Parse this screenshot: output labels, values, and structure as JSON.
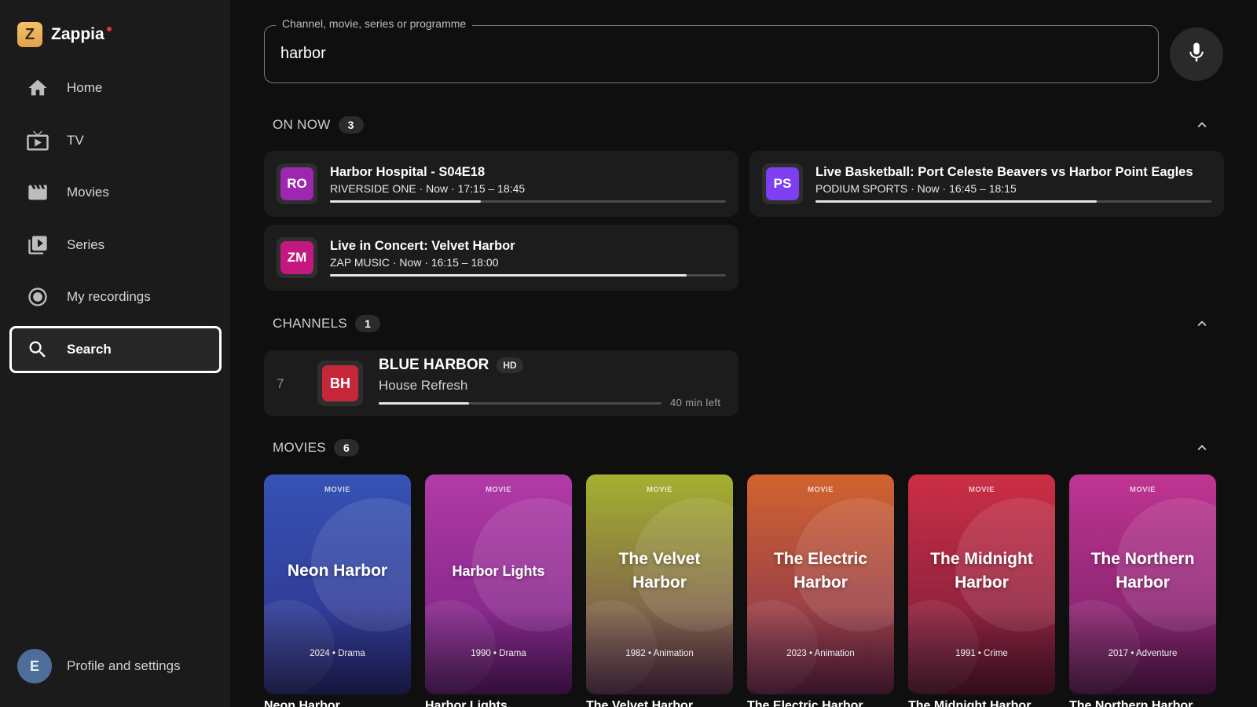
{
  "app": {
    "name": "Zappia",
    "logo_letter": "Z"
  },
  "sidebar": {
    "items": [
      {
        "label": "Home",
        "icon": "home-icon"
      },
      {
        "label": "TV",
        "icon": "tv-icon"
      },
      {
        "label": "Movies",
        "icon": "clapperboard-icon"
      },
      {
        "label": "Series",
        "icon": "series-icon"
      },
      {
        "label": "My recordings",
        "icon": "record-icon"
      },
      {
        "label": "Search",
        "icon": "search-icon",
        "active": true
      }
    ],
    "profile": {
      "initial": "E",
      "label": "Profile and settings",
      "avatar_color": "#4e6e9a"
    }
  },
  "search": {
    "label": "Channel, movie, series or programme",
    "value": "harbor"
  },
  "on_now": {
    "title": "ON NOW",
    "count": "3",
    "items": [
      {
        "logo": "RO",
        "logo_color": "#9c27b0",
        "title": "Harbor Hospital - S04E18",
        "meta": "RIVERSIDE ONE · Now · 17:15 – 18:45",
        "progress": 0.38
      },
      {
        "logo": "PS",
        "logo_color": "#7e3ff2",
        "title": "Live Basketball: Port Celeste Beavers vs Harbor Point Eagles",
        "meta": "PODIUM SPORTS · Now · 16:45 – 18:15",
        "progress": 0.71
      },
      {
        "logo": "ZM",
        "logo_color": "#c2187f",
        "title": "Live in Concert: Velvet Harbor",
        "meta": "ZAP MUSIC · Now · 16:15 – 18:00",
        "progress": 0.9
      }
    ]
  },
  "channels": {
    "title": "CHANNELS",
    "count": "1",
    "items": [
      {
        "number": "7",
        "logo": "BH",
        "logo_color": "#c62839",
        "name": "BLUE HARBOR",
        "badge": "HD",
        "program": "House Refresh",
        "time_left": "40 min left",
        "progress": 0.32
      }
    ]
  },
  "movies": {
    "title": "MOVIES",
    "count": "6",
    "items": [
      {
        "kind": "MOVIE",
        "title": "Neon Harbor",
        "sub": "2024 • Drama",
        "caption": "Neon Harbor",
        "colors": [
          "#3553b5",
          "#2f2f86"
        ]
      },
      {
        "kind": "MOVIE",
        "title": "Harbor Lights",
        "sub": "1990 • Drama",
        "caption": "Harbor Lights",
        "colors": [
          "#b23aa7",
          "#6f1f7e"
        ]
      },
      {
        "kind": "MOVIE",
        "title": "The Velvet Harbor",
        "sub": "1982 • Animation",
        "caption": "The Velvet Harbor",
        "colors": [
          "#a5b12f",
          "#6c3a5a"
        ]
      },
      {
        "kind": "MOVIE",
        "title": "The Electric Harbor",
        "sub": "2023 • Animation",
        "caption": "The Electric Harbor",
        "colors": [
          "#d2632f",
          "#7a2c55"
        ]
      },
      {
        "kind": "MOVIE",
        "title": "The Midnight Harbor",
        "sub": "1991 • Crime",
        "caption": "The Midnight Harbor",
        "colors": [
          "#cc2e45",
          "#6e1c3c"
        ]
      },
      {
        "kind": "MOVIE",
        "title": "The Northern Harbor",
        "sub": "2017 • Adventure",
        "caption": "The Northern Harbor",
        "colors": [
          "#c03492",
          "#6e1f62"
        ]
      }
    ]
  }
}
